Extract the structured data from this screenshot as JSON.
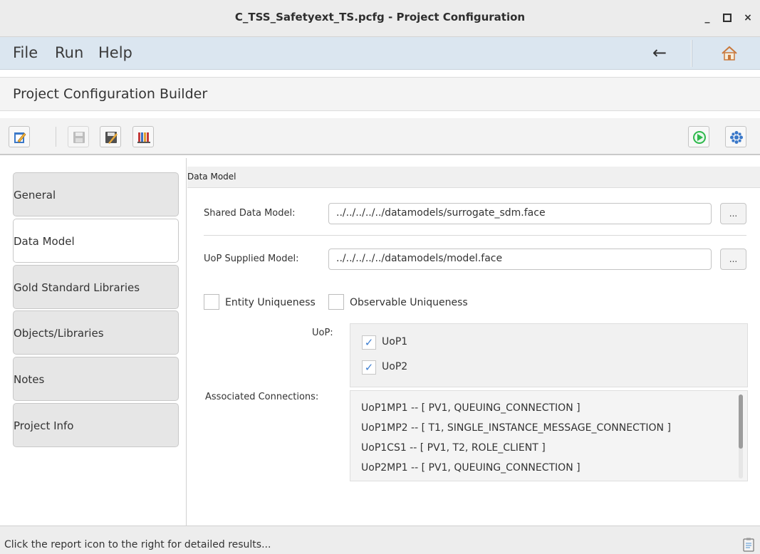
{
  "window": {
    "title": "C_TSS_Safetyext_TS.pcfg - Project Configuration",
    "minimize": "_",
    "maximize": "□",
    "close": "×"
  },
  "menu": {
    "items": [
      "File",
      "Run",
      "Help"
    ],
    "back_icon": "back-arrow-icon",
    "home_icon": "home-icon"
  },
  "builder": {
    "title": "Project Configuration Builder"
  },
  "toolbar": {
    "left_icons": [
      "edit-config-icon",
      "save-icon",
      "save-as-icon",
      "library-icon"
    ],
    "right_icons": [
      "run-icon",
      "settings-icon"
    ]
  },
  "nav": {
    "tabs": [
      {
        "label": "General",
        "active": false
      },
      {
        "label": "Data Model",
        "active": true
      },
      {
        "label": "Gold Standard Libraries",
        "active": false
      },
      {
        "label": "Objects/Libraries",
        "active": false
      },
      {
        "label": "Notes",
        "active": false
      },
      {
        "label": "Project Info",
        "active": false
      }
    ]
  },
  "data_model": {
    "section_title": "Data Model",
    "shared_label": "Shared Data Model:",
    "shared_value": "../../../../../datamodels/surrogate_sdm.face",
    "uop_supplied_label": "UoP Supplied Model:",
    "uop_supplied_value": "../../../../../datamodels/model.face",
    "browse_label": "...",
    "entity_uniqueness": "Entity Uniqueness",
    "observable_uniqueness": "Observable Uniqueness",
    "uop_label": "UoP:",
    "uops": [
      {
        "label": "UoP1",
        "checked": true
      },
      {
        "label": "UoP2",
        "checked": true
      }
    ],
    "connections_label": "Associated Connections:",
    "connections": [
      "UoP1MP1 -- [ PV1, QUEUING_CONNECTION ]",
      "UoP1MP2 -- [ T1, SINGLE_INSTANCE_MESSAGE_CONNECTION ]",
      "UoP1CS1 -- [ PV1, T2, ROLE_CLIENT ]",
      "UoP2MP1 -- [ PV1, QUEUING_CONNECTION ]"
    ]
  },
  "status": {
    "text": "Click the report icon to the right for detailed results...",
    "report_icon": "report-icon"
  },
  "colors": {
    "menubar": "#dbe6f0",
    "check": "#3f7fd1",
    "run_green": "#2eb84c"
  }
}
